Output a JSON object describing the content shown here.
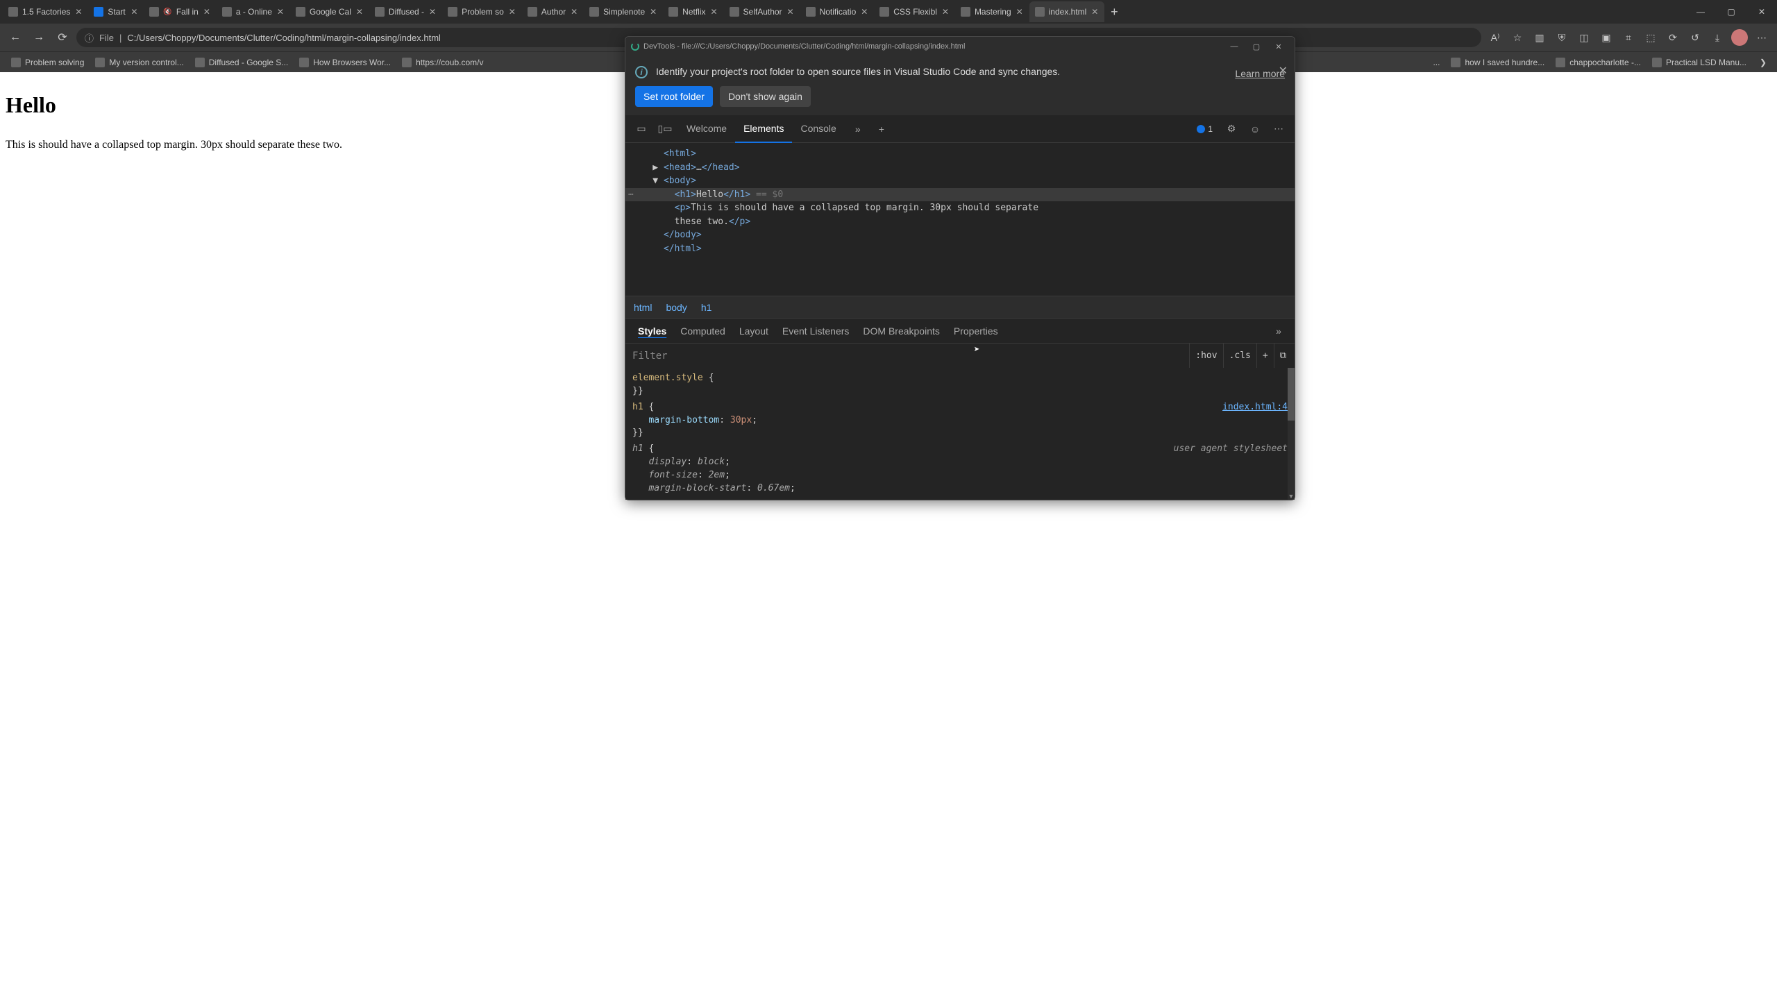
{
  "window_controls": {
    "min": "—",
    "max": "▢",
    "close": "✕"
  },
  "tabs": [
    {
      "label": "1.5 Factories",
      "fav": "fv-pink"
    },
    {
      "label": "Start",
      "fav": "fv-blue",
      "badge": true
    },
    {
      "label": "Fall in",
      "fav": "fv-red",
      "muted": true
    },
    {
      "label": "a - Online",
      "fav": "fv-green"
    },
    {
      "label": "Google Cal",
      "fav": "fv-blue"
    },
    {
      "label": "Diffused -",
      "fav": "fv-green"
    },
    {
      "label": "Problem so",
      "fav": "fv-purple"
    },
    {
      "label": "Author",
      "fav": "fv-grey"
    },
    {
      "label": "Simplenote",
      "fav": "fv-blue"
    },
    {
      "label": "Netflix",
      "fav": "fv-red"
    },
    {
      "label": "SelfAuthor",
      "fav": "fv-grey"
    },
    {
      "label": "Notificatio",
      "fav": "fv-black"
    },
    {
      "label": "CSS Flexibl",
      "fav": "fv-grey"
    },
    {
      "label": "Mastering",
      "fav": "fv-grey"
    },
    {
      "label": "index.html",
      "fav": "fv-white",
      "active": true
    }
  ],
  "address": {
    "scheme_icon": "ⓘ",
    "scheme": "File",
    "path": "C:/Users/Choppy/Documents/Clutter/Coding/html/margin-collapsing/index.html"
  },
  "bookmarks_left": [
    {
      "label": "Problem solving",
      "fav": "fv-purple"
    },
    {
      "label": "My version control...",
      "fav": "fv-grey"
    },
    {
      "label": "Diffused - Google S...",
      "fav": "fv-green"
    },
    {
      "label": "How Browsers Wor...",
      "fav": "fv-blue"
    },
    {
      "label": "https://coub.com/v",
      "fav": "fv-blue"
    }
  ],
  "bookmarks_right": [
    {
      "label": "..."
    },
    {
      "label": "how I saved hundre...",
      "fav": "fv-red"
    },
    {
      "label": "chappocharlotte -...",
      "fav": "fv-blue"
    },
    {
      "label": "Practical LSD Manu...",
      "fav": "fv-grey"
    }
  ],
  "page": {
    "h1": "Hello",
    "p": "This is should have a collapsed top margin. 30px should separate these two."
  },
  "devtools": {
    "title": "DevTools - file:///C:/Users/Choppy/Documents/Clutter/Coding/html/margin-collapsing/index.html",
    "info_text": "Identify your project's root folder to open source files in Visual Studio Code and sync changes.",
    "learn_more": "Learn more",
    "btn_primary": "Set root folder",
    "btn_secondary": "Don't show again",
    "tabs": [
      "Welcome",
      "Elements",
      "Console"
    ],
    "active_tab": "Elements",
    "issues_count": "1",
    "dom_lines": [
      {
        "indent": 1,
        "html": "<span class='tagc'>&lt;html&gt;</span>"
      },
      {
        "indent": 1,
        "caret": "▶",
        "html": "<span class='tagc'>&lt;head&gt;</span><span class='txtc'>…</span><span class='tagc'>&lt;/head&gt;</span>"
      },
      {
        "indent": 1,
        "caret": "▼",
        "html": "<span class='tagc'>&lt;body&gt;</span>"
      },
      {
        "indent": 2,
        "sel": true,
        "dots": "⋯",
        "html": "<span class='tagc'>&lt;h1&gt;</span><span class='txtc'>Hello</span><span class='tagc'>&lt;/h1&gt;</span> <span class='cmt'>== $0</span>"
      },
      {
        "indent": 2,
        "html": "<span class='tagc'>&lt;p&gt;</span><span class='txtc'>This is should have a collapsed top margin. 30px should separate </span>"
      },
      {
        "indent": 2,
        "html": "<span class='txtc'>these two.</span><span class='tagc'>&lt;/p&gt;</span>"
      },
      {
        "indent": 1,
        "html": "<span class='tagc'>&lt;/body&gt;</span>"
      },
      {
        "indent": 1,
        "html": "<span class='tagc'>&lt;/html&gt;</span>"
      }
    ],
    "breadcrumbs": [
      "html",
      "body",
      "h1"
    ],
    "style_tabs": [
      "Styles",
      "Computed",
      "Layout",
      "Event Listeners",
      "DOM Breakpoints",
      "Properties"
    ],
    "style_active": "Styles",
    "filter_placeholder": "Filter",
    "filter_btns": [
      ":hov",
      ".cls",
      "+",
      "⧉"
    ],
    "rules": [
      {
        "selector": "element.style",
        "props": [],
        "src": ""
      },
      {
        "selector": "h1",
        "props": [
          {
            "k": "margin-bottom",
            "v": "30px"
          }
        ],
        "src": "index.html:4"
      },
      {
        "selector": "h1",
        "ua": true,
        "props": [
          {
            "k": "display",
            "v": "block"
          },
          {
            "k": "font-size",
            "v": "2em"
          },
          {
            "k": "margin-block-start",
            "v": "0.67em"
          }
        ],
        "src": "user agent stylesheet"
      }
    ]
  }
}
